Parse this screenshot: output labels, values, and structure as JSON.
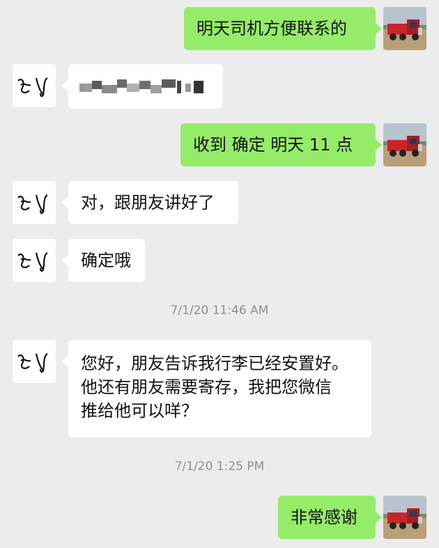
{
  "messages": {
    "m1": {
      "sender": "me",
      "text": "明天司机方便联系的"
    },
    "m2": {
      "sender": "them",
      "text": ""
    },
    "m3": {
      "sender": "me",
      "text": "收到 确定 明天 11 点"
    },
    "m4": {
      "sender": "them",
      "text": "对，跟朋友讲好了"
    },
    "m5": {
      "sender": "them",
      "text": "确定哦"
    },
    "m6": {
      "sender": "them",
      "text": "您好，朋友告诉我行李已经安置好。\n他还有朋友需要寄存，我把您微信\n推给他可以咩？"
    },
    "m7": {
      "sender": "me",
      "text": "非常感谢"
    }
  },
  "timestamps": {
    "t1": "7/1/20 11:46 AM",
    "t2": "7/1/20 1:25 PM"
  },
  "avatars": {
    "me_icon": "truck-icon",
    "them_icon": "handwritten-initials-icon"
  },
  "colors": {
    "background": "#ececec",
    "my_bubble": "#95ec69",
    "their_bubble": "#ffffff",
    "timestamp_text": "#8f8f8f"
  }
}
